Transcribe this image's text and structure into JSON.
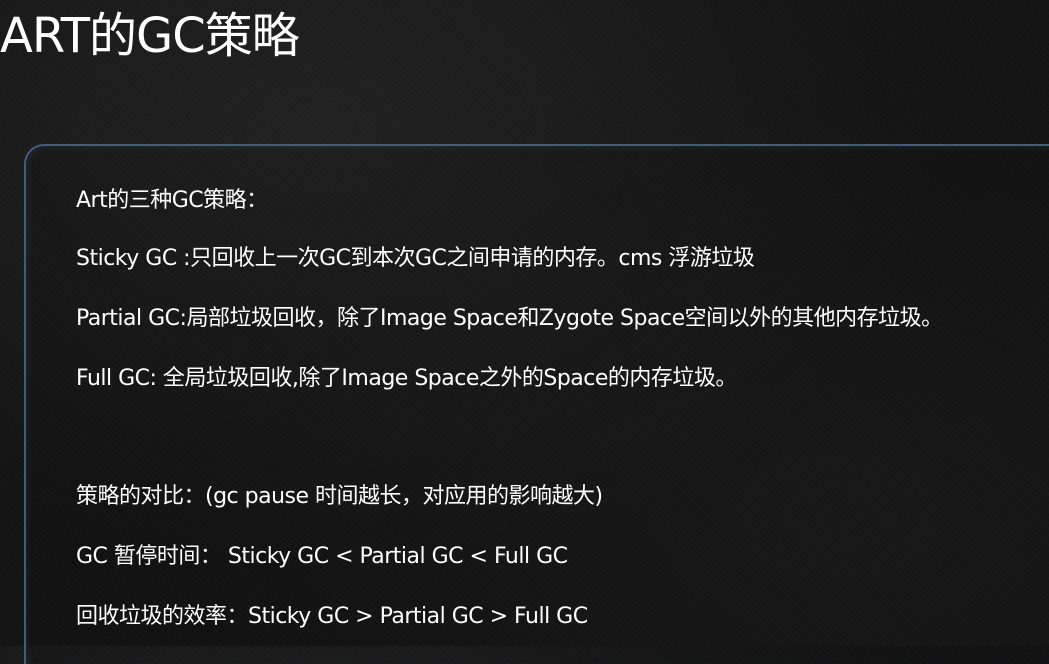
{
  "slide": {
    "title": "ART的GC策略",
    "lines": [
      "Art的三种GC策略：",
      "Sticky GC :只回收上一次GC到本次GC之间申请的内存。cms 浮游垃圾",
      "Partial GC:局部垃圾回收，除了Image Space和Zygote Space空间以外的其他内存垃圾。",
      "Full GC: 全局垃圾回收,除了Image Space之外的Space的内存垃圾。",
      "策略的对比：(gc pause 时间越长，对应用的影响越大)",
      "GC 暂停时间：  Sticky GC < Partial GC < Full GC",
      "回收垃圾的效率：Sticky GC > Partial GC > Full GC"
    ]
  },
  "colors": {
    "background": "#141414",
    "panel_border": "#3f5e7d",
    "text": "#ffffff"
  }
}
